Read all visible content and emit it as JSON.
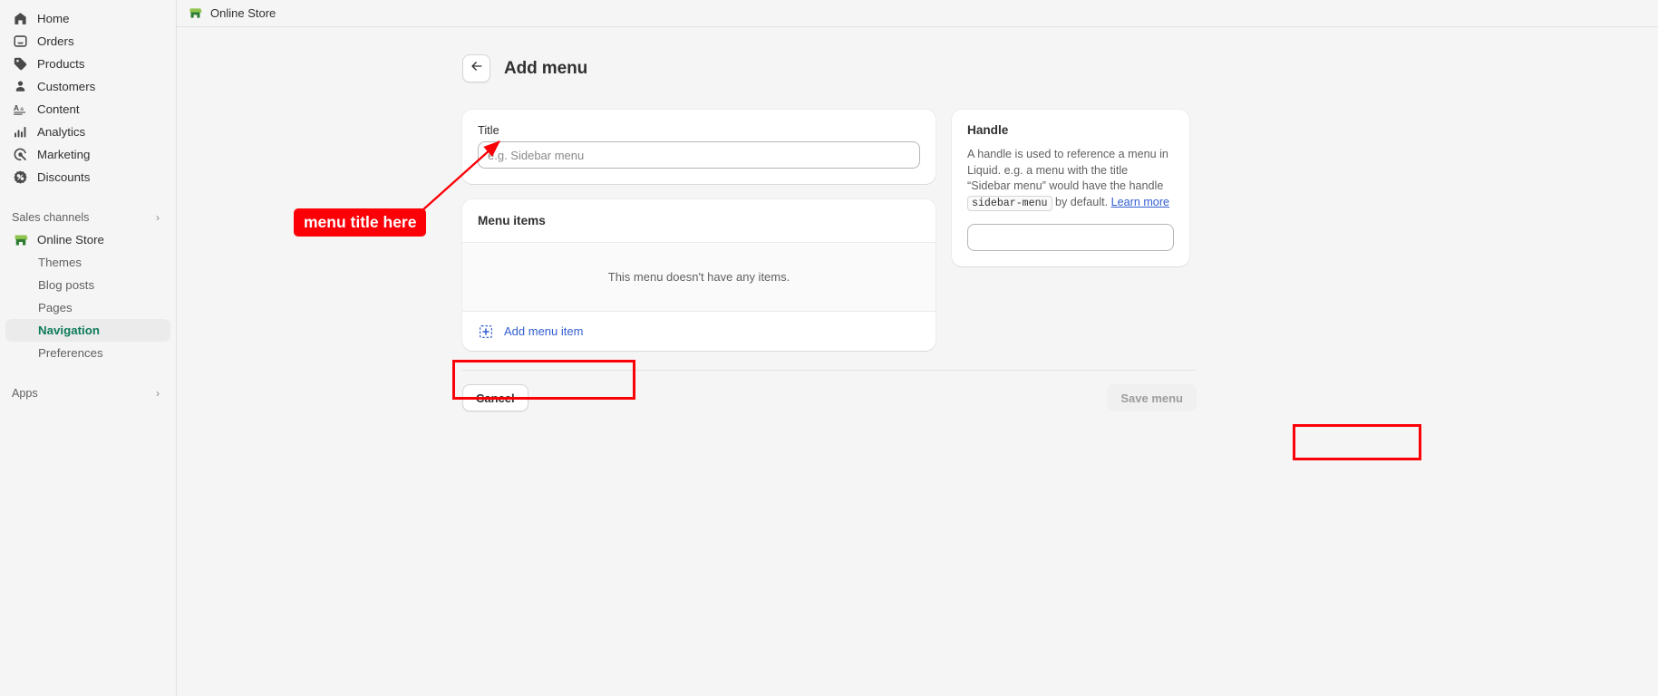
{
  "topbar": {
    "title": "Online Store",
    "icon": "storefront-icon"
  },
  "sidebar": {
    "items": [
      {
        "label": "Home",
        "icon": "home-icon"
      },
      {
        "label": "Orders",
        "icon": "orders-inbox-icon"
      },
      {
        "label": "Products",
        "icon": "products-tag-icon"
      },
      {
        "label": "Customers",
        "icon": "customers-person-icon"
      },
      {
        "label": "Content",
        "icon": "content-text-icon"
      },
      {
        "label": "Analytics",
        "icon": "analytics-bars-icon"
      },
      {
        "label": "Marketing",
        "icon": "marketing-target-icon"
      },
      {
        "label": "Discounts",
        "icon": "discounts-percent-icon"
      }
    ],
    "sales_channels": {
      "label": "Sales channels",
      "chevron": "chevron-right-icon"
    },
    "store": {
      "label": "Online Store",
      "icon": "storefront-icon"
    },
    "store_subitems": [
      {
        "label": "Themes",
        "active": false
      },
      {
        "label": "Blog posts",
        "active": false
      },
      {
        "label": "Pages",
        "active": false
      },
      {
        "label": "Navigation",
        "active": true
      },
      {
        "label": "Preferences",
        "active": false
      }
    ],
    "apps": {
      "label": "Apps",
      "chevron": "chevron-right-icon"
    }
  },
  "page": {
    "back_icon": "arrow-left-icon",
    "title": "Add menu"
  },
  "title_card": {
    "label": "Title",
    "value": "",
    "placeholder": "e.g. Sidebar menu"
  },
  "menu_items_card": {
    "heading": "Menu items",
    "empty_text": "This menu doesn't have any items.",
    "add_item_label": "Add menu item",
    "add_item_icon": "dashed-square-plus-icon"
  },
  "handle_card": {
    "heading": "Handle",
    "description_part1": "A handle is used to reference a menu in Liquid. e.g. a menu with the title “Sidebar menu” would have the handle ",
    "code": "sidebar-menu",
    "description_part2": " by default. ",
    "learn_more": "Learn more",
    "input_value": "",
    "input_placeholder": ""
  },
  "footer": {
    "cancel_label": "Cancel",
    "save_label": "Save menu",
    "save_disabled": true
  },
  "annotations": {
    "color": "#fb0007",
    "callout_text": "menu title here",
    "highlight_add_item": "Add menu item",
    "highlight_save": "Save menu"
  },
  "colors": {
    "accent_green": "#0e7b5c",
    "link_blue": "#325ece",
    "annotation_red": "#fb0007",
    "sidebar_bg": "#f5f5f5",
    "page_bg": "#f5f5f5"
  }
}
